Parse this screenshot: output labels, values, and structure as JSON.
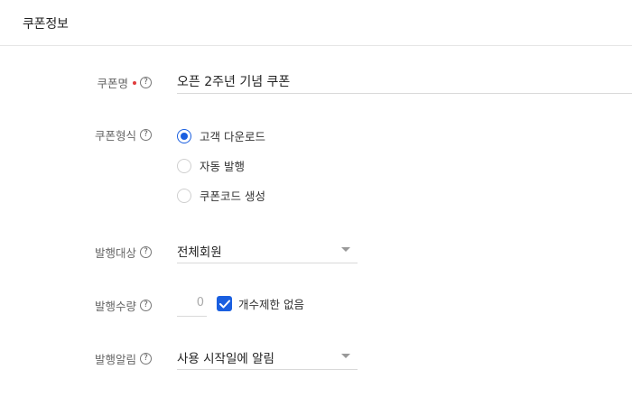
{
  "header": {
    "title": "쿠폰정보"
  },
  "coupon_name": {
    "label": "쿠폰명",
    "required": true,
    "value": "오픈 2주년 기념 쿠폰"
  },
  "coupon_type": {
    "label": "쿠폰형식",
    "options": [
      {
        "label": "고객 다운로드",
        "checked": true
      },
      {
        "label": "자동 발행",
        "checked": false
      },
      {
        "label": "쿠폰코드 생성",
        "checked": false
      }
    ]
  },
  "target": {
    "label": "발행대상",
    "selected": "전체회원"
  },
  "quantity": {
    "label": "발행수량",
    "value": "0",
    "unlimited_label": "개수제한 없음",
    "unlimited_checked": true
  },
  "notify": {
    "label": "발행알림",
    "selected": "사용 시작일에 알림"
  },
  "colors": {
    "accent": "#1a5fe0",
    "required": "#e03c3c"
  },
  "icons": {
    "help": "help-circle-icon",
    "check": "check-icon",
    "caret": "chevron-down-icon"
  }
}
